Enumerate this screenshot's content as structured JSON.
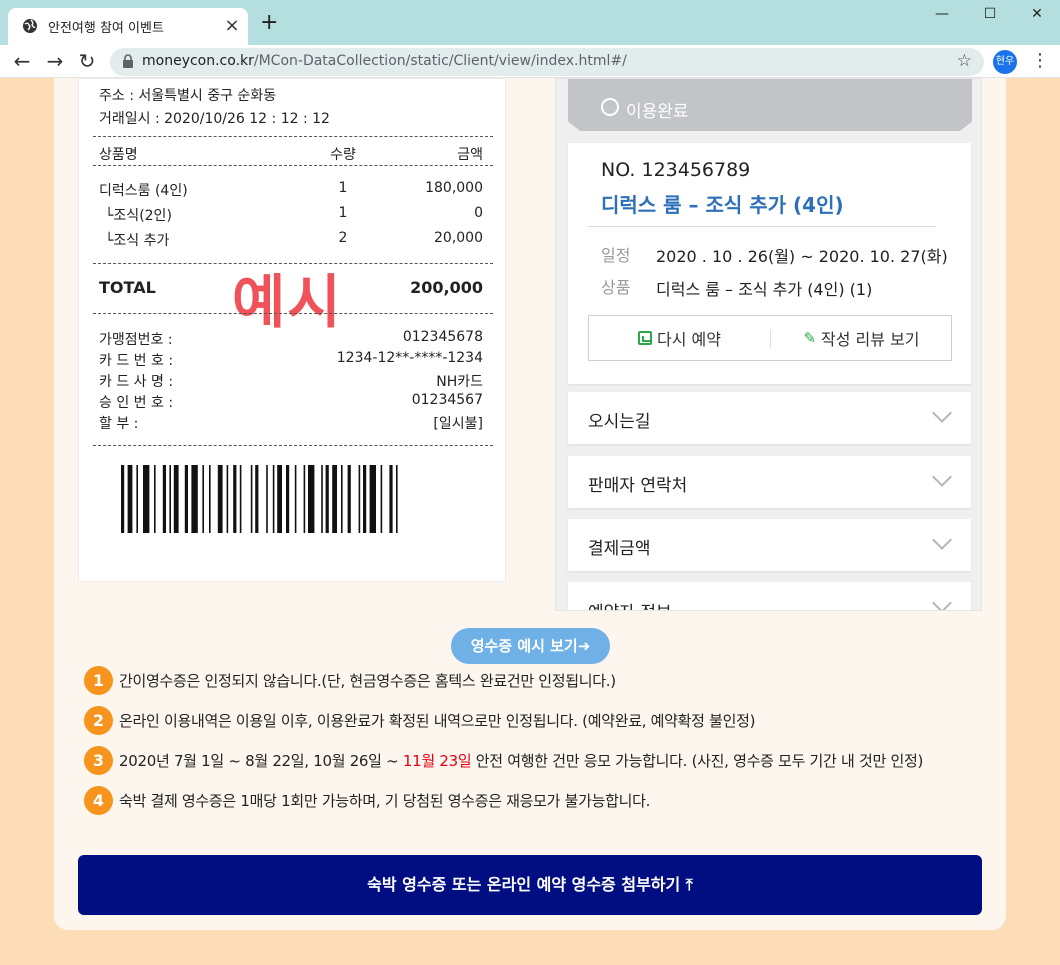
{
  "browser": {
    "tab_title": "안전여행 참여 이벤트",
    "tab_close": "×",
    "new_tab": "+",
    "url_domain": "moneycon.co.kr",
    "url_path": "/MCon-DataCollection/static/Client/view/index.html#/",
    "profile": "현우",
    "win_minimize": "—",
    "win_maximize": "☐",
    "win_close": "✕",
    "nav_back": "←",
    "nav_forward": "→",
    "nav_reload": "↻",
    "bookmark": "☆",
    "menu": "⋮"
  },
  "receipt": {
    "address": "주소 : 서울특별시 중구 순화동",
    "datetime": "거래일시 : 2020/10/26  12 : 12 : 12",
    "headers": {
      "name": "상품명",
      "qty": "수량",
      "amount": "금액"
    },
    "items": [
      {
        "name": "디럭스룸 (4인)",
        "qty": "1",
        "amount": "180,000"
      },
      {
        "name": "└조식(2인)",
        "qty": "1",
        "amount": "0"
      },
      {
        "name": "└조식 추가",
        "qty": "2",
        "amount": "20,000"
      }
    ],
    "total_label": "TOTAL",
    "total_amount": "200,000",
    "watermark": "예시",
    "card_info": [
      {
        "label": "가맹점번호 :",
        "value": "012345678"
      },
      {
        "label": "카 드 번 호 :",
        "value": "1234-12**-****-1234"
      },
      {
        "label": "카 드 사 명 :",
        "value": "NH카드"
      },
      {
        "label": "승 인 번 호 :",
        "value": "01234567"
      },
      {
        "label": "할         부 :",
        "value": "[일시불]"
      }
    ]
  },
  "reservation": {
    "status": "이용완료",
    "order_no": "NO. 123456789",
    "product_title": "디럭스 룸 – 조식 추가 (4인)",
    "schedule_label": "일정",
    "schedule_value": "2020 . 10 . 26(월) ~ 2020. 10. 27(화)",
    "product_label": "상품",
    "product_value": "디럭스 룸 – 조식 추가 (4인) (1)",
    "rebook_button": "다시 예약",
    "review_button": "작성 리뷰 보기",
    "accordions": [
      "오시는길",
      "판매자 연락처",
      "결제금액",
      "예약자 정보"
    ]
  },
  "example_button": "영수증 예시 보기➜",
  "notes": [
    {
      "num": "1",
      "text": "간이영수증은 인정되지 않습니다.(단, 현금영수증은 홈텍스 완료건만 인정됩니다.)"
    },
    {
      "num": "2",
      "text": "온라인 이용내역은 이용일 이후, 이용완료가 확정된 내역으로만 인정됩니다. (예약완료, 예약확정 불인정)"
    },
    {
      "num": "3",
      "text_before": "2020년 7월 1일 ~ 8월 22일, 10월 26일 ~ ",
      "text_highlight": "11월 23일",
      "text_after": " 안전 여행한 건만 응모 가능합니다. (사진, 영수증 모두 기간 내 것만 인정)"
    },
    {
      "num": "4",
      "text": "숙박 결제 영수증은 1매당 1회만 가능하며, 기 당첨된 영수증은 재응모가 불가능합니다."
    }
  ],
  "upload_button": "숙박 영수증 또는 온라인 예약 영수증 첨부하기 ⤒",
  "colors": {
    "page_bg": "#fddcb8",
    "accent_blue": "#2d6fb8",
    "upload_bg": "#000e82",
    "note_badge": "#f7941d",
    "highlight_red": "#e60012",
    "watermark_red": "#f0525a"
  }
}
